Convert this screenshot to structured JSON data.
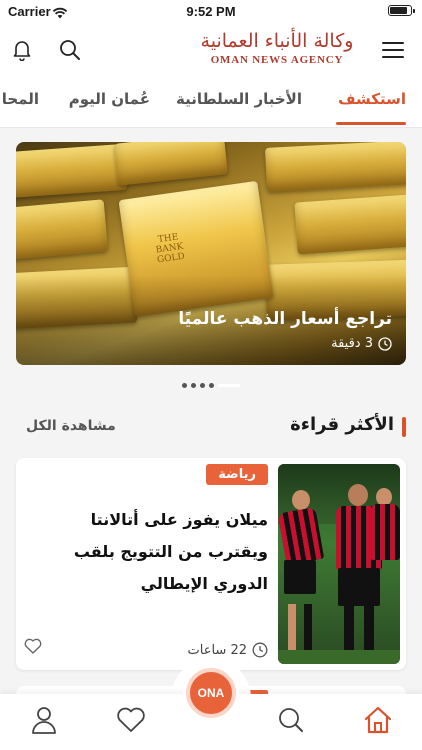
{
  "status_bar": {
    "carrier": "Carrier",
    "time": "9:52 PM",
    "battery_level": 0.9
  },
  "header": {
    "logo_arabic": "وكالة الأنباء العمانية",
    "logo_english": "OMAN NEWS AGENCY"
  },
  "tabs": [
    {
      "label": "استكشف",
      "active": true
    },
    {
      "label": "الأخبار السلطانية",
      "active": false
    },
    {
      "label": "عُمان اليوم",
      "active": false
    },
    {
      "label": "المحا",
      "active": false
    }
  ],
  "hero": {
    "title": "تراجع أسعار الذهب عالميًا",
    "time": "3 دقيقة",
    "bar_label_line1": "THE",
    "bar_label_line2": "BANK",
    "bar_label_line3": "GOLD"
  },
  "carousel": {
    "count": 5,
    "active_index": 4
  },
  "most_read": {
    "title": "الأكثر قراءة",
    "see_all": "مشاهدة الكل"
  },
  "article": {
    "category": "رياضة",
    "title": "ميلان يفوز على أتالانتا ويقترب من التتويج بلقب الدوري الإيطالي",
    "time": "22 ساعات"
  },
  "bottom_nav": {
    "center_label": "ONA",
    "items": [
      "home-icon",
      "search-icon",
      "heart-icon",
      "user-icon"
    ]
  },
  "colors": {
    "accent": "#d9532c",
    "badge": "#e8623a",
    "logo": "#b03a2e"
  }
}
